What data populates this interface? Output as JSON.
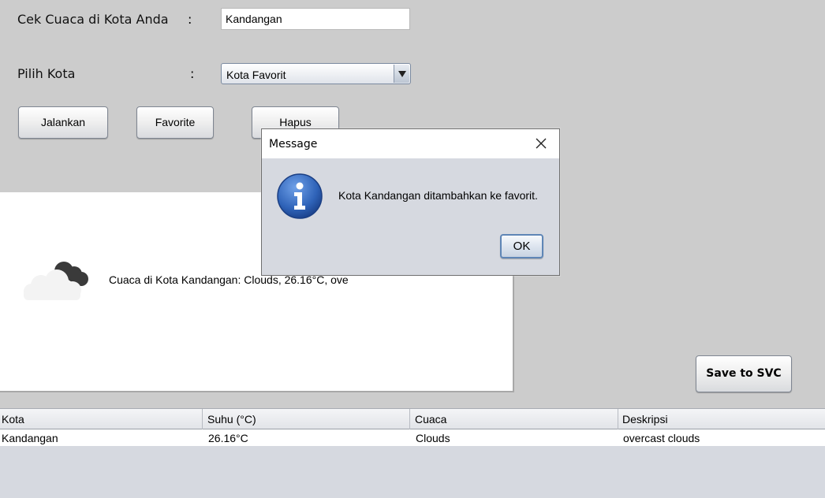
{
  "form": {
    "city_label": "Cek Cuaca di Kota Anda",
    "city_colon": ":",
    "city_value": "Kandangan",
    "choose_label": "Pilih Kota",
    "choose_colon": ":",
    "choose_selected": "Kota Favorit"
  },
  "buttons": {
    "run": "Jalankan",
    "favorite": "Favorite",
    "delete": "Hapus",
    "save": "Save to SVC"
  },
  "weather": {
    "icon": "cloud-icon",
    "text": "Cuaca di Kota Kandangan: Clouds, 26.16°C, ove"
  },
  "table": {
    "headers": [
      "Kota",
      "Suhu (°C)",
      "Cuaca",
      "Deskripsi"
    ],
    "rows": [
      [
        "Kandangan",
        "26.16°C",
        "Clouds",
        "overcast clouds"
      ]
    ]
  },
  "dialog": {
    "title": "Message",
    "icon": "info-icon",
    "message": "Kota Kandangan ditambahkan ke favorit.",
    "ok": "OK"
  },
  "colors": {
    "window_bg": "#cccccc",
    "dialog_bg": "#d6d9e0",
    "info_blue": "#2f63b8"
  }
}
